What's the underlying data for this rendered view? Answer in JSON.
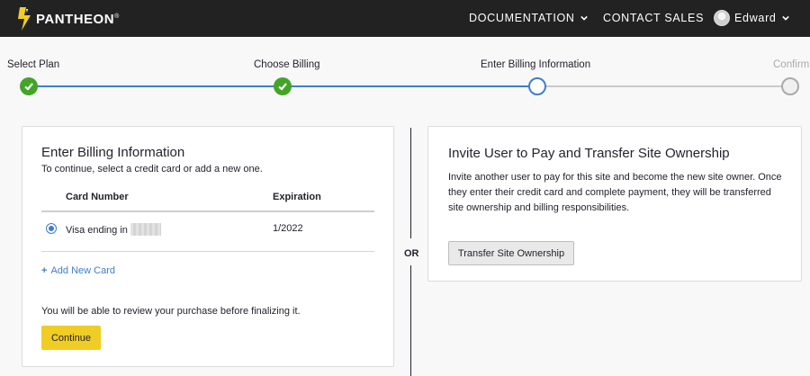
{
  "nav": {
    "logo_text": "PANTHEON",
    "logo_registered": "®",
    "documentation_label": "DOCUMENTATION",
    "contact_sales_label": "CONTACT SALES",
    "user_name": "Edward"
  },
  "steps": [
    {
      "label": "Select Plan",
      "state": "done"
    },
    {
      "label": "Choose Billing",
      "state": "done"
    },
    {
      "label": "Enter Billing Information",
      "state": "current"
    },
    {
      "label": "Confirm",
      "state": "todo"
    }
  ],
  "billing": {
    "title": "Enter Billing Information",
    "subtitle": "To continue, select a credit card or add a new one.",
    "col_card": "Card Number",
    "col_expiration": "Expiration",
    "card_label": "Visa ending in",
    "card_expiration": "1/2022",
    "add_card_label": "Add New Card",
    "review_note": "You will be able to review your purchase before finalizing it.",
    "continue_label": "Continue"
  },
  "or_label": "OR",
  "transfer": {
    "title": "Invite User to Pay and Transfer Site Ownership",
    "description": "Invite another user to pay for this site and become the new site owner. Once they enter their credit card and complete payment, they will be transferred site ownership and billing responsibilities.",
    "button_label": "Transfer Site Ownership"
  },
  "colors": {
    "accent": "#3f7ecd",
    "success": "#43a528",
    "cta": "#f0cd24",
    "topbar": "#222222"
  }
}
